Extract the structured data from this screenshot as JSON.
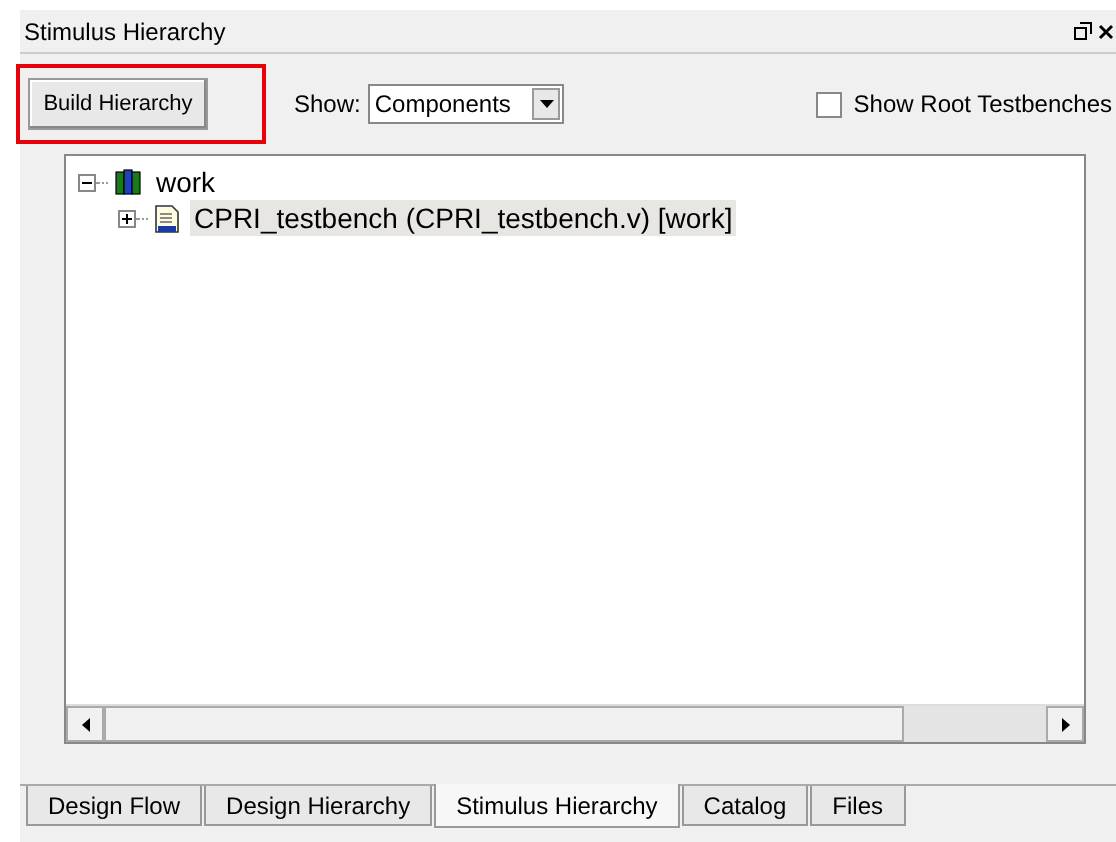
{
  "panel": {
    "title": "Stimulus Hierarchy"
  },
  "toolbar": {
    "build_button": {
      "label": "Build Hierarchy",
      "highlighted": true
    },
    "show_label": "Show:",
    "show_value": "Components",
    "root_testbenches": {
      "label": "Show Root Testbenches",
      "checked": false
    }
  },
  "tree": [
    {
      "label": "work",
      "kind": "library",
      "expanded": true,
      "selected": false,
      "children": [
        {
          "label": "CPRI_testbench (CPRI_testbench.v) [work]",
          "kind": "file",
          "expanded": false,
          "selected": true
        }
      ]
    }
  ],
  "tabs": [
    {
      "label": "Design Flow",
      "selected": false
    },
    {
      "label": "Design Hierarchy",
      "selected": false
    },
    {
      "label": "Stimulus Hierarchy",
      "selected": true
    },
    {
      "label": "Catalog",
      "selected": false
    },
    {
      "label": "Files",
      "selected": false
    }
  ]
}
